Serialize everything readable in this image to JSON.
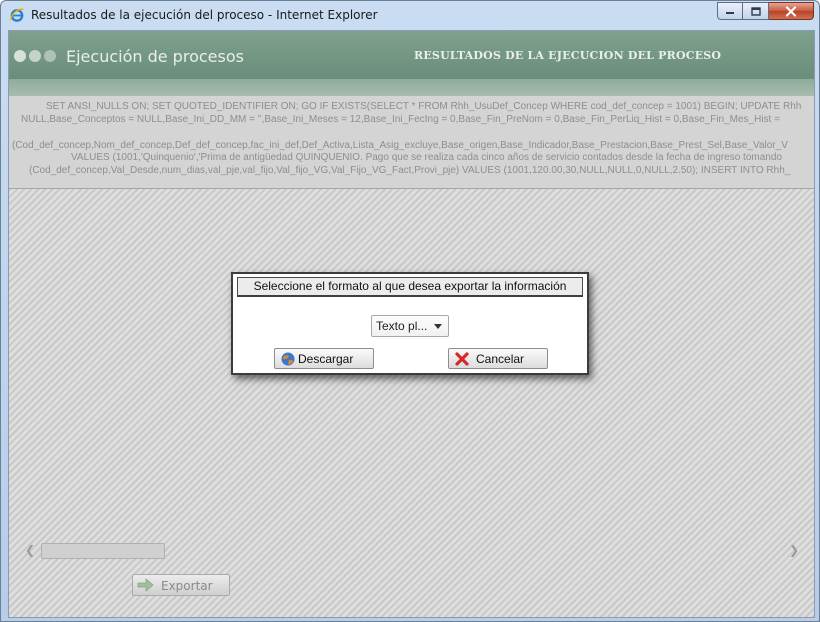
{
  "window": {
    "title": "Resultados de la ejecución del proceso - Internet Explorer"
  },
  "app": {
    "title": "Ejecución de procesos",
    "section_title": "RESULTADOS DE LA EJECUCION DEL PROCESO",
    "sql_lines": [
      "SET ANSI_NULLS ON; SET QUOTED_IDENTIFIER ON; GO IF EXISTS(SELECT * FROM Rhh_UsuDef_Concep WHERE cod_def_concep = 1001) BEGIN; UPDATE Rhh",
      "NULL,Base_Conceptos = NULL,Base_Ini_DD_MM = '',Base_Ini_Meses = 12,Base_Ini_FecIng = 0,Base_Fin_PreNom = 0,Base_Fin_PerLiq_Hist = 0,Base_Fin_Mes_Hist =",
      "(Cod_def_concep,Nom_def_concep,Def_def_concep,fac_ini_def,Def_Activa,Lista_Asig_excluye,Base_origen,Base_Indicador,Base_Prestacion,Base_Prest_Sel,Base_Valor_V",
      "VALUES (1001,'Quinquenio','Prima de antigüedad QUINQUENIO. Pago que se realiza cada cinco años de servicio contados desde la fecha de ingreso tomando",
      "(Cod_def_concep,Val_Desde,num_dias,val_pje,val_fijo,Val_fijo_VG,Val_Fijo_VG_Fact,Provi_pje) VALUES (1001,120.00,30,NULL,NULL,0,NULL,2.50); INSERT INTO Rhh_"
    ],
    "export_label": "Exportar"
  },
  "modal": {
    "heading": "Seleccione el formato al que desea exportar la información",
    "format_selected": "Texto pl...",
    "download_label": "Descargar",
    "cancel_label": "Cancelar"
  },
  "colors": {
    "header_green": "#6f9380",
    "cancel_icon_red": "#d42a2a"
  }
}
